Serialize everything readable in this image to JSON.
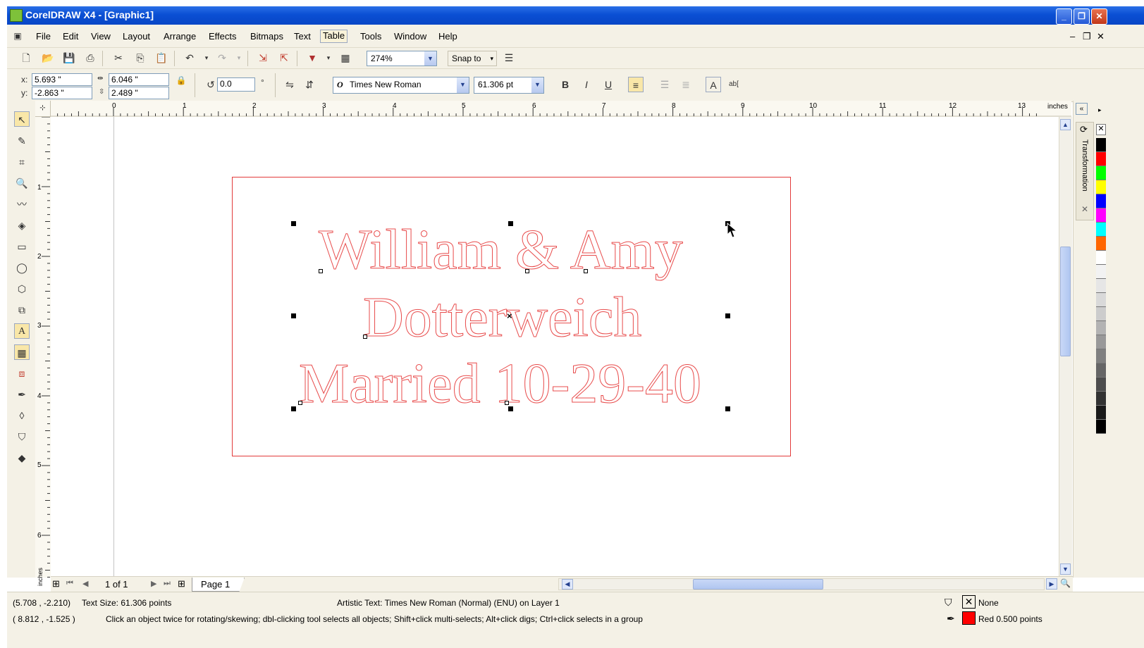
{
  "window": {
    "title": "CorelDRAW X4 - [Graphic1]"
  },
  "menu": [
    "File",
    "Edit",
    "View",
    "Layout",
    "Arrange",
    "Effects",
    "Bitmaps",
    "Text",
    "Table",
    "Tools",
    "Window",
    "Help"
  ],
  "toolbar": {
    "zoom": "274%",
    "snap_to": "Snap to"
  },
  "property_bar": {
    "x_label": "x:",
    "x_value": "5.693 \"",
    "y_label": "y:",
    "y_value": "-2.863 \"",
    "width_value": "6.046 \"",
    "height_value": "2.489 \"",
    "rotation_value": "0.0",
    "degree_symbol": "°",
    "font_name": "Times New Roman",
    "font_size": "61.306 pt",
    "ab_label": "ab["
  },
  "ruler": {
    "unit": "inches",
    "h_ticks": [
      "0",
      "1",
      "2",
      "3",
      "4",
      "5",
      "6",
      "7",
      "8",
      "9",
      "10",
      "11",
      "12",
      "13"
    ],
    "v_ticks": [
      "1",
      "2",
      "3",
      "4",
      "5",
      "6"
    ],
    "v_unit": "inches"
  },
  "canvas": {
    "text_line1": "William & Amy",
    "text_line2": "Dotterweich",
    "text_line3": "Married 10-29-40",
    "outline_color": "#e84c4c"
  },
  "docker": {
    "title": "Transformation"
  },
  "page_nav": {
    "counter": "1 of 1",
    "tab": "Page 1"
  },
  "palette_colors": [
    "#000000",
    "#ff0000",
    "#00ff00",
    "#ffff00",
    "#0000ff",
    "#ff00ff",
    "#00ffff",
    "#ff6600",
    "#ffffff",
    "#f2f2f2",
    "#e6e6e6",
    "#d9d9d9",
    "#cccccc",
    "#b3b3b3",
    "#999999",
    "#808080",
    "#666666",
    "#4d4d4d",
    "#333333",
    "#1a1a1a",
    "#000000"
  ],
  "status": {
    "coords1": "(5.708 , -2.210)",
    "text_size": "Text Size: 61.306 points",
    "object_info": "Artistic Text: Times New Roman (Normal) (ENU) on Layer 1",
    "coords2": "( 8.812 , -1.525 )",
    "hint": "Click an object twice for rotating/skewing; dbl-clicking tool selects all objects; Shift+click multi-selects; Alt+click digs; Ctrl+click selects in a group",
    "fill_label": "None",
    "outline_label": "Red  0.500 points",
    "outline_color": "#ff0000"
  }
}
